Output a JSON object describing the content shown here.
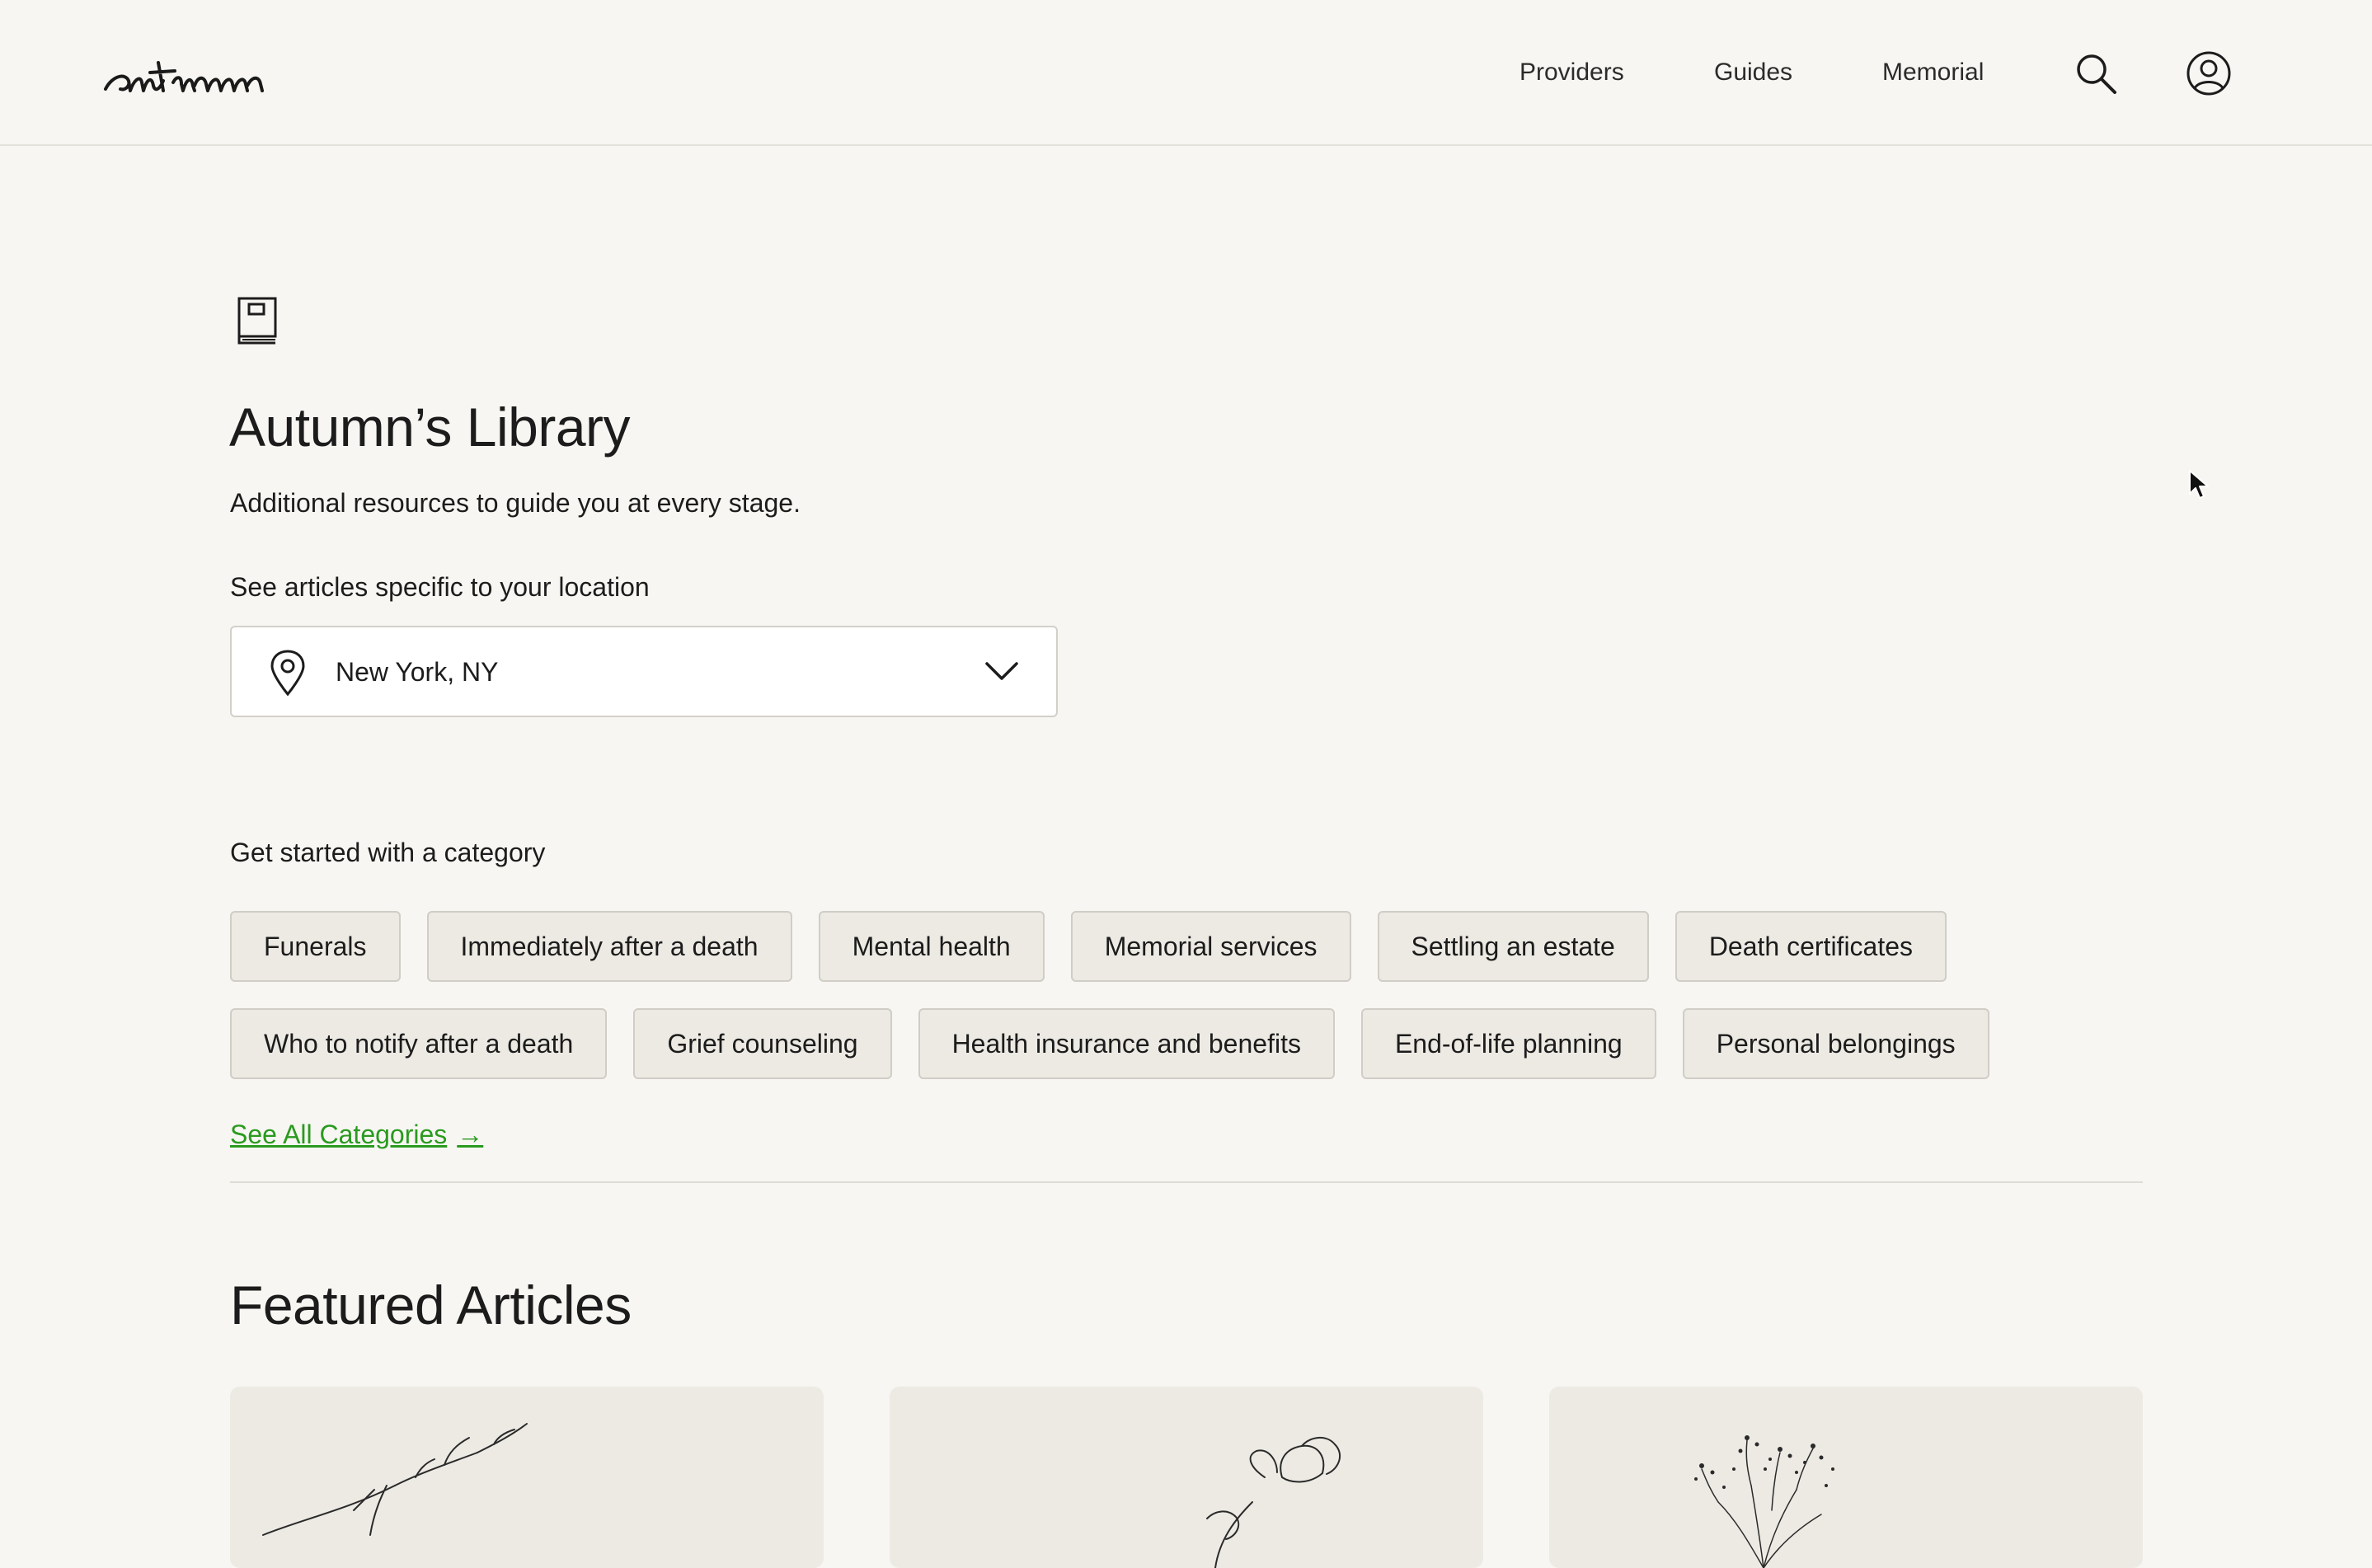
{
  "header": {
    "logo_text": "autumn",
    "nav": {
      "providers": "Providers",
      "guides": "Guides",
      "memorial": "Memorial"
    },
    "icons": [
      "search-icon",
      "account-icon"
    ]
  },
  "library": {
    "icon": "book-icon",
    "title": "Autumn’s Library",
    "subtitle": "Additional resources to guide you at every stage.",
    "location_label": "See articles specific to your location",
    "location_value": "New York, NY"
  },
  "categories": {
    "label": "Get started with a category",
    "row1": [
      "Funerals",
      "Immediately after a death",
      "Mental health",
      "Memorial services",
      "Settling an estate",
      "Death certificates"
    ],
    "row2": [
      "Who to notify after a death",
      "Grief counseling",
      "Health insurance and benefits",
      "End-of-life planning",
      "Personal belongings"
    ],
    "see_all": "See All Categories",
    "see_all_arrow": "→"
  },
  "featured": {
    "title": "Featured Articles"
  },
  "colors": {
    "background": "#f7f6f2",
    "chip_bg": "#eceae3",
    "link_green": "#2a9a1f"
  }
}
